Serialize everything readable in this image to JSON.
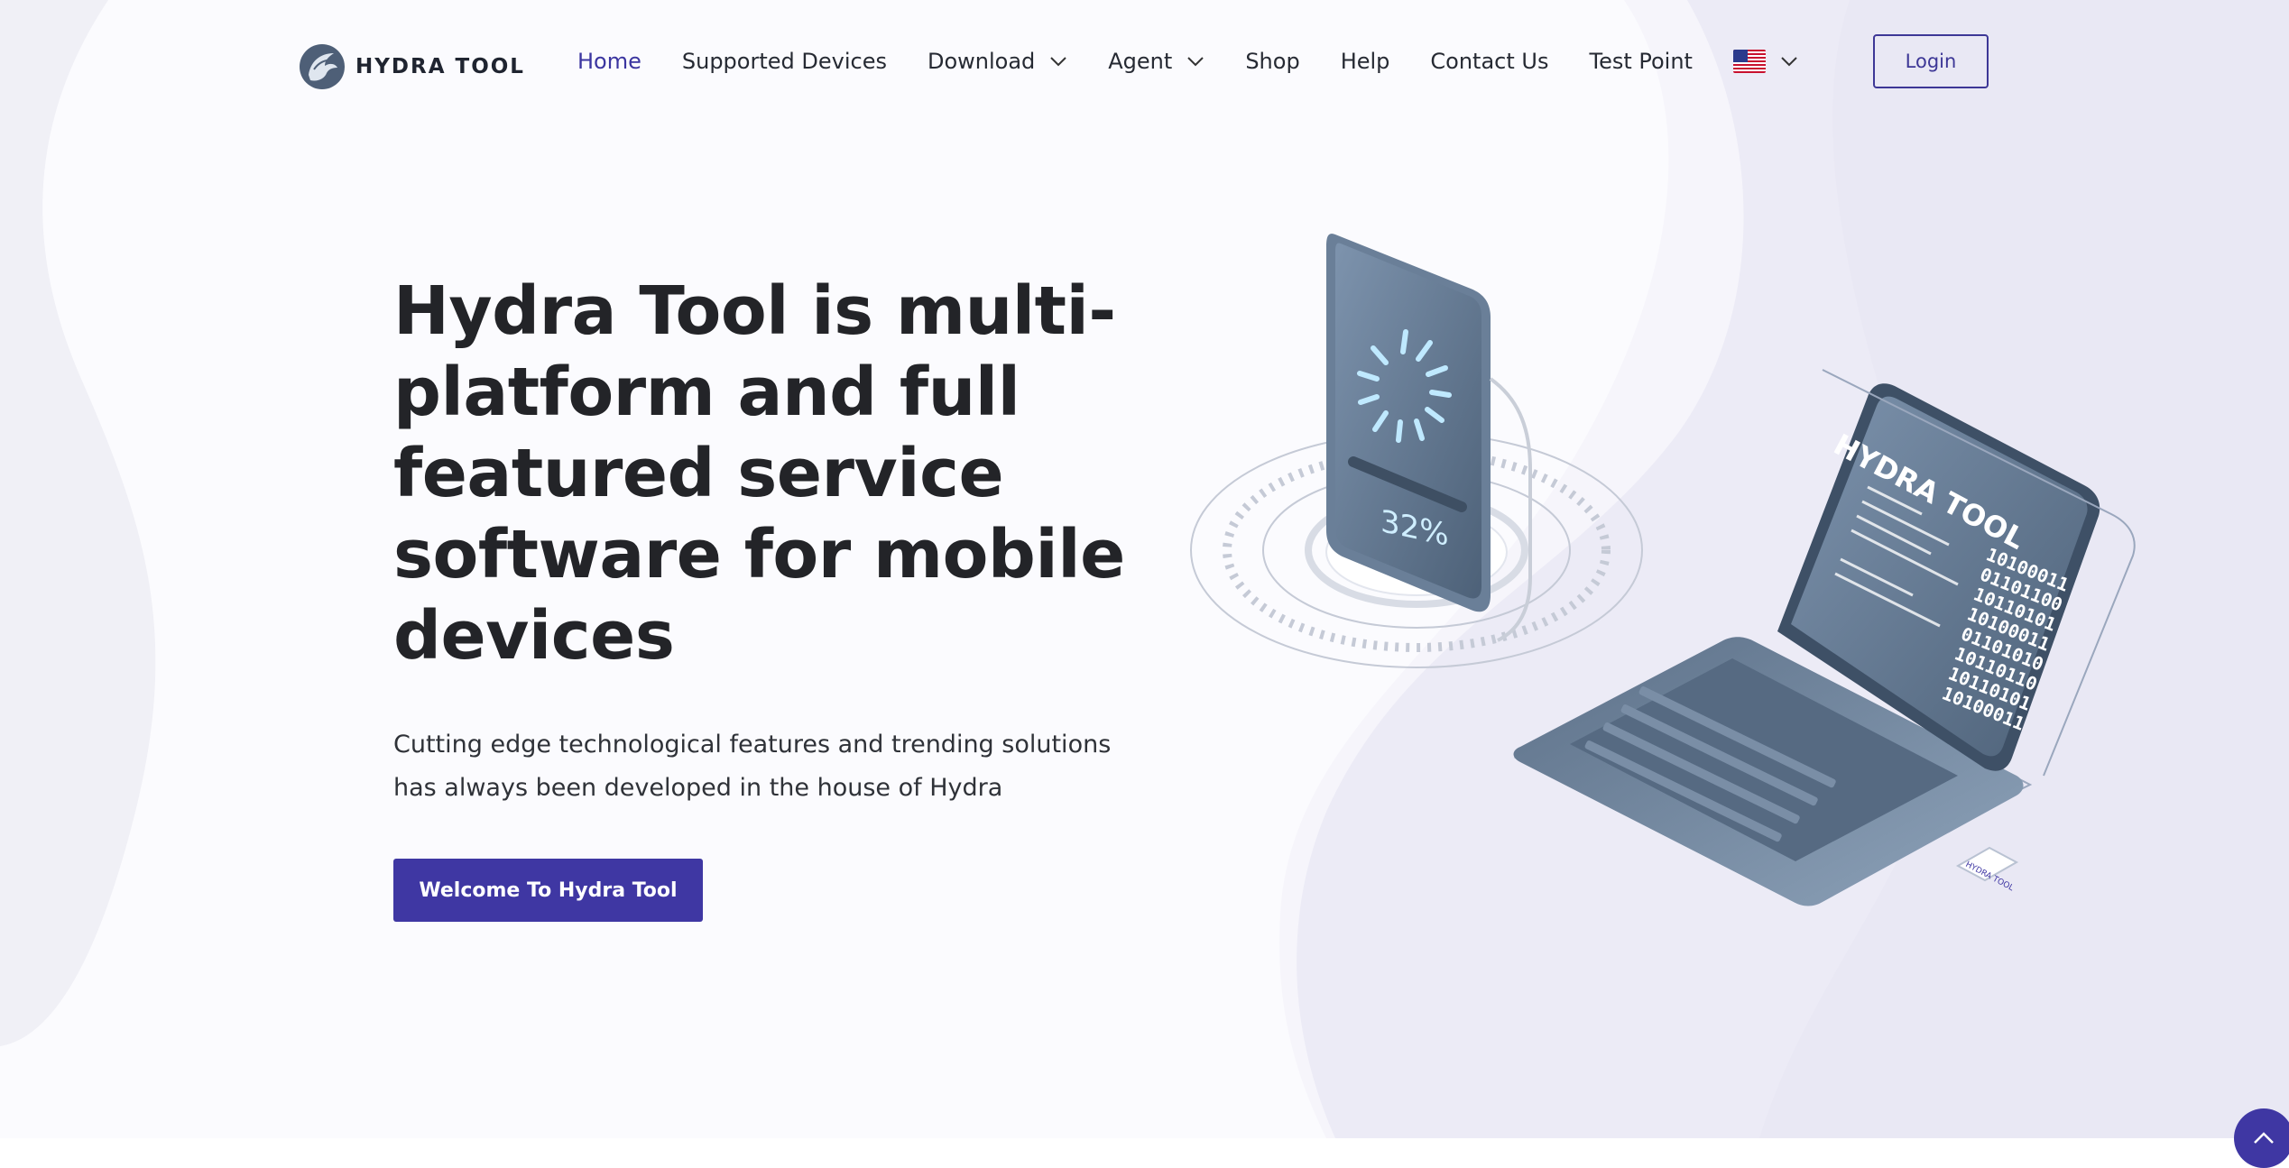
{
  "brand": {
    "name": "HYDRA TOOL"
  },
  "nav": {
    "items": [
      {
        "label": "Home"
      },
      {
        "label": "Supported Devices"
      },
      {
        "label": "Download"
      },
      {
        "label": "Agent"
      },
      {
        "label": "Shop"
      },
      {
        "label": "Help"
      },
      {
        "label": "Contact Us"
      },
      {
        "label": "Test Point"
      }
    ],
    "active": "Home",
    "language_icon": "us-flag-icon",
    "login_label": "Login"
  },
  "hero": {
    "title": "Hydra Tool is multi-platform and full featured service software for mobile devices",
    "subtitle": "Cutting edge technological features and trending solutions has always been developed in the house of Hydra",
    "cta_label": "Welcome To Hydra Tool"
  },
  "illustration": {
    "phone_progress": "32%",
    "laptop_brand": "HYDRA TOOL",
    "binary_lines": [
      "10100011",
      "01101100",
      "10110101",
      "10100011",
      "01101010",
      "10110110",
      "10110101",
      "10100011"
    ],
    "usb_label": "HYDRA TOOL"
  },
  "colors": {
    "accent": "#3f37a3",
    "text": "#232428",
    "background": "#f7f6fb"
  }
}
